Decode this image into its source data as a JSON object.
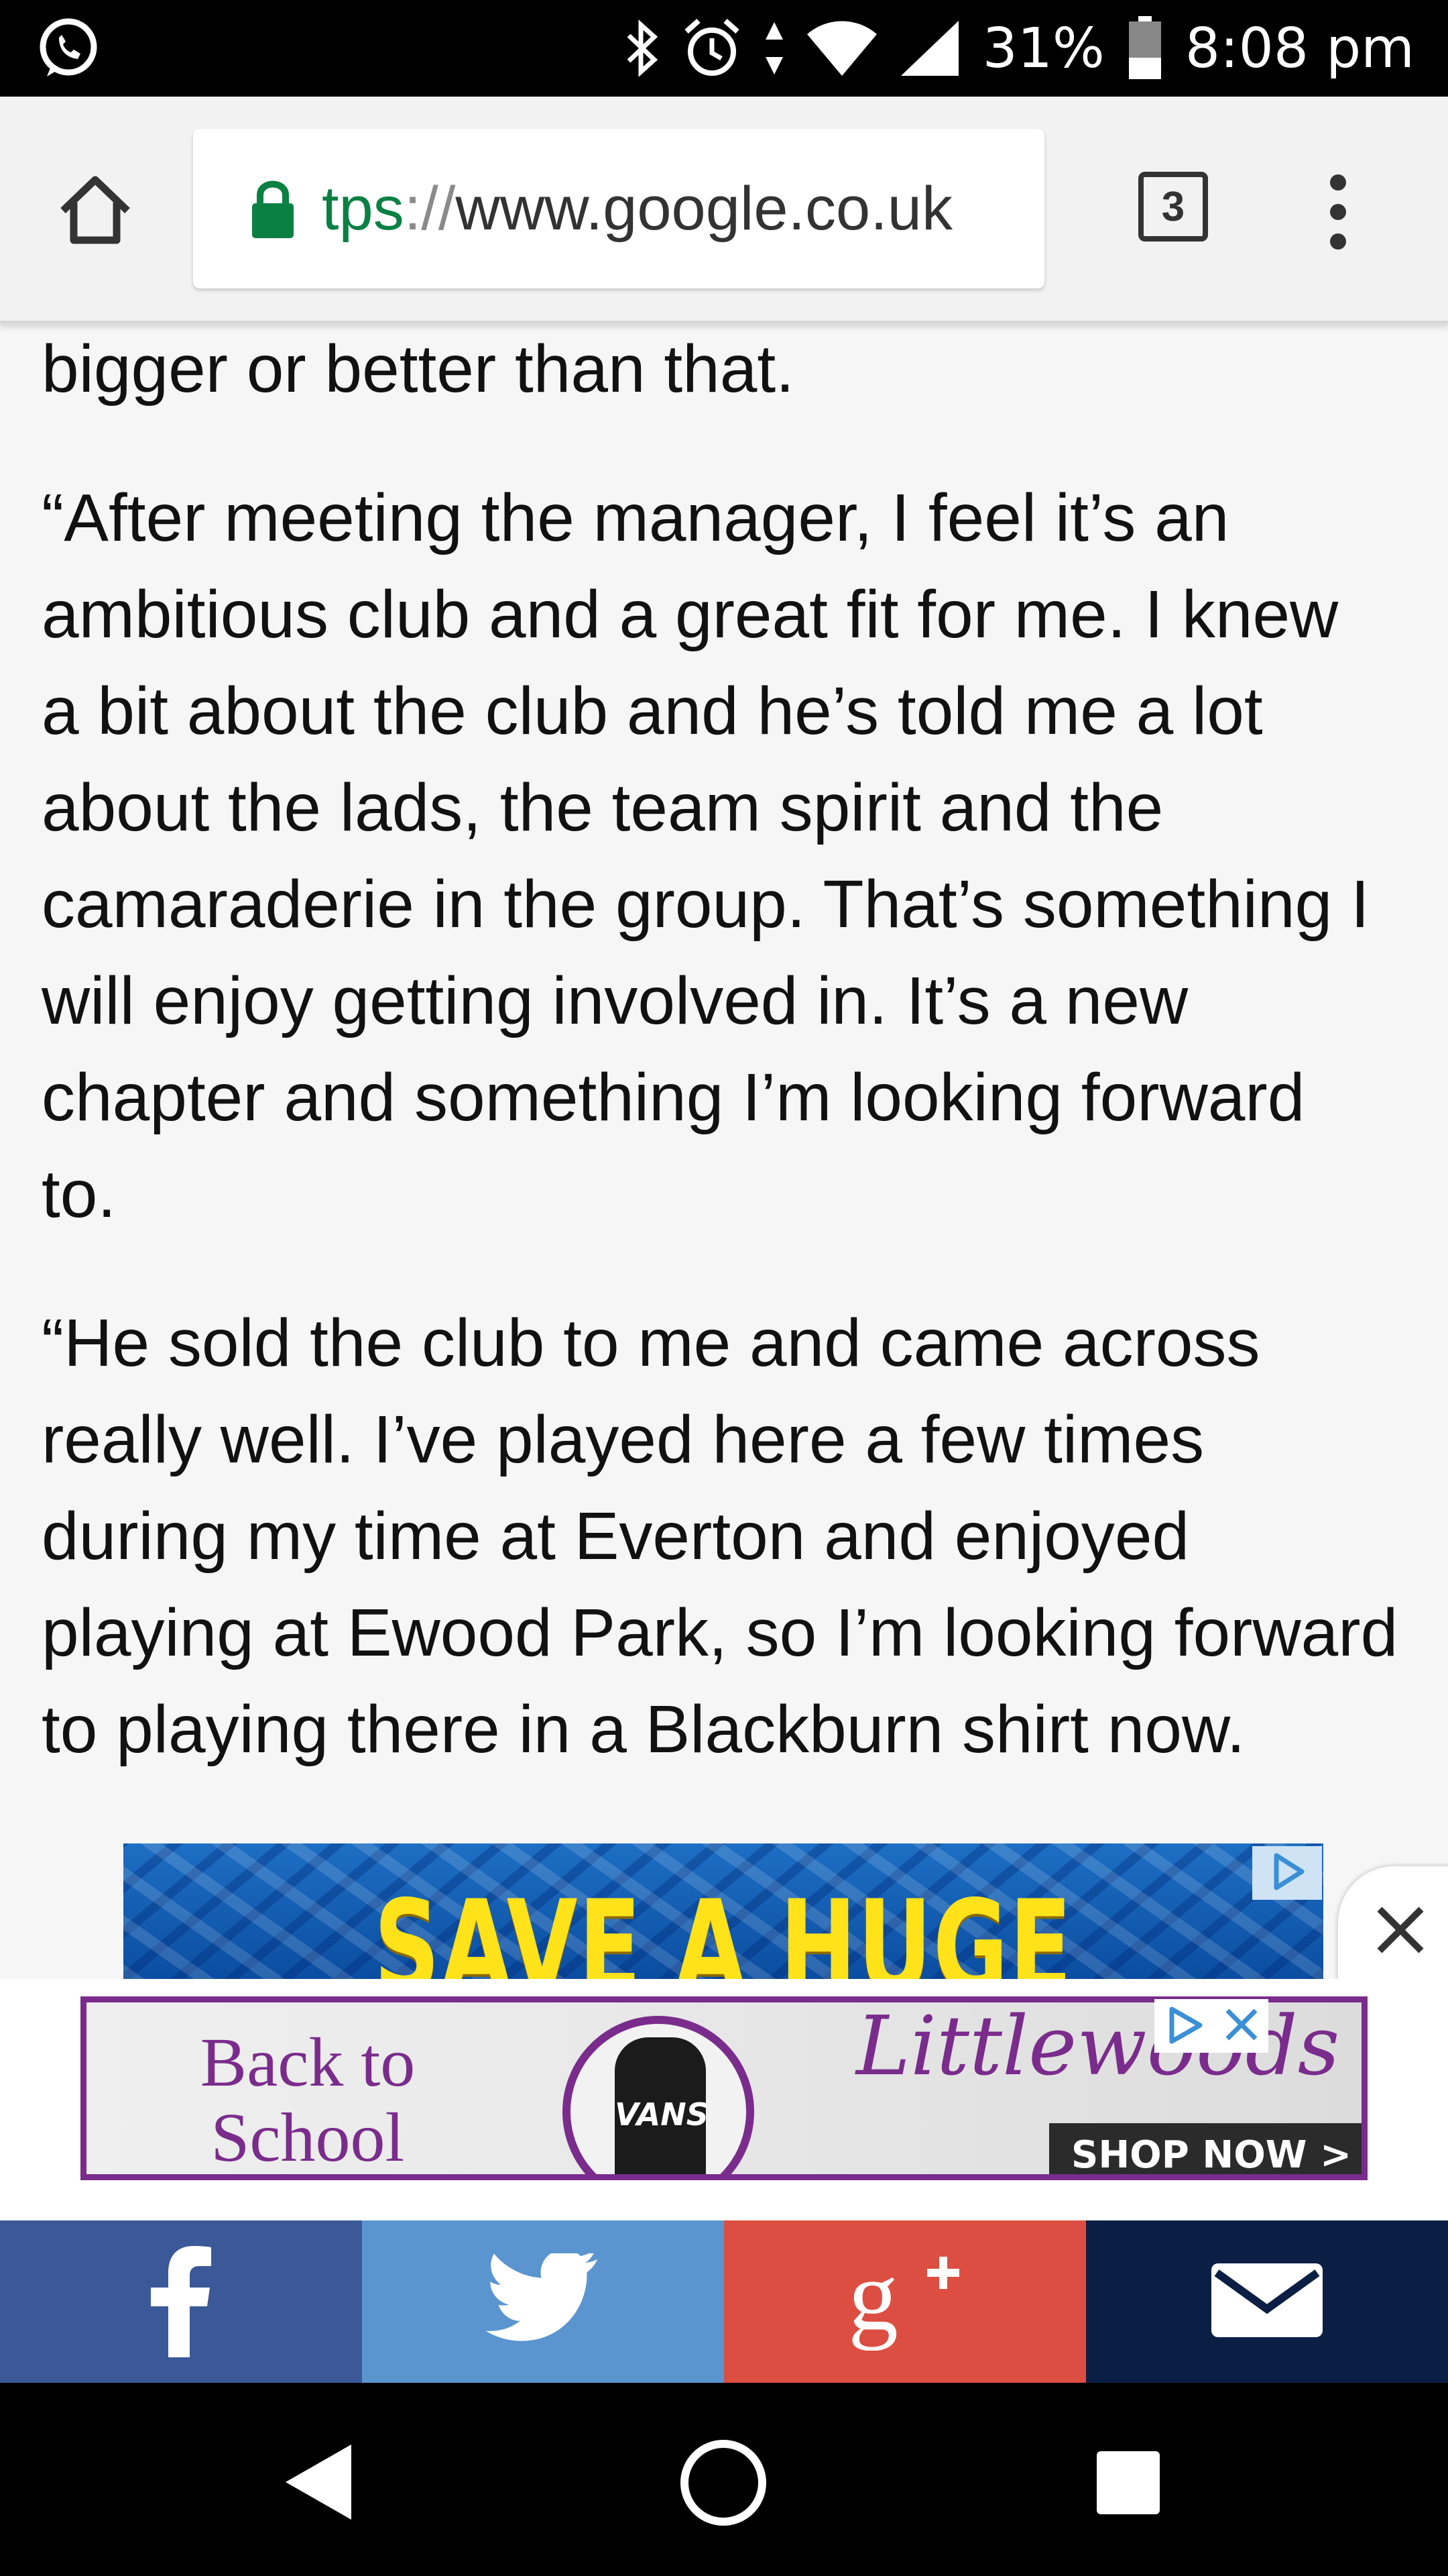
{
  "status_bar": {
    "left_icon": "whatsapp-icon",
    "icons": [
      "bluetooth-icon",
      "alarm-icon",
      "data-arrows-icon",
      "wifi-icon",
      "signal-icon"
    ],
    "battery_percent": "31%",
    "time": "8:08 pm"
  },
  "browser": {
    "url_scheme": "tps",
    "url_separator": "://",
    "url_host": "www.google.co.uk",
    "tab_count": "3"
  },
  "article": {
    "para0": "bigger or better than that.",
    "para1_lines": [
      "“After meeting the manager, I feel it’s an",
      "ambitious club and a great fit for me. I knew",
      "a bit about the club and he’s told me a lot",
      "about the lads, the team spirit and the",
      "camaraderie in the group. That’s something I",
      "will enjoy getting involved in. It’s a new",
      "chapter and something I’m looking forward",
      "to."
    ],
    "para2_lines": [
      "“He sold the club to me and came across",
      "really well. I’ve played here a few times",
      "during my time at Everton and enjoyed",
      "playing at Ewood Park, so I’m looking forward",
      "to playing there in a Blackburn shirt now."
    ]
  },
  "ads": {
    "pool_headline": "SAVE A HUGE",
    "littlewoods": {
      "tagline_1": "Back to",
      "tagline_2": "School",
      "bag_logo": "VANS",
      "brand": "Littlewoods",
      "cta": "SHOP NOW >"
    }
  },
  "share": {
    "buttons": [
      "facebook-icon",
      "twitter-icon",
      "google-plus-icon",
      "email-icon"
    ],
    "colors": [
      "#3b5998",
      "#5a95d0",
      "#dc4e41",
      "#0b1f45"
    ]
  },
  "nav": {
    "buttons": [
      "back-icon",
      "home-circle-icon",
      "recent-apps-icon"
    ]
  }
}
